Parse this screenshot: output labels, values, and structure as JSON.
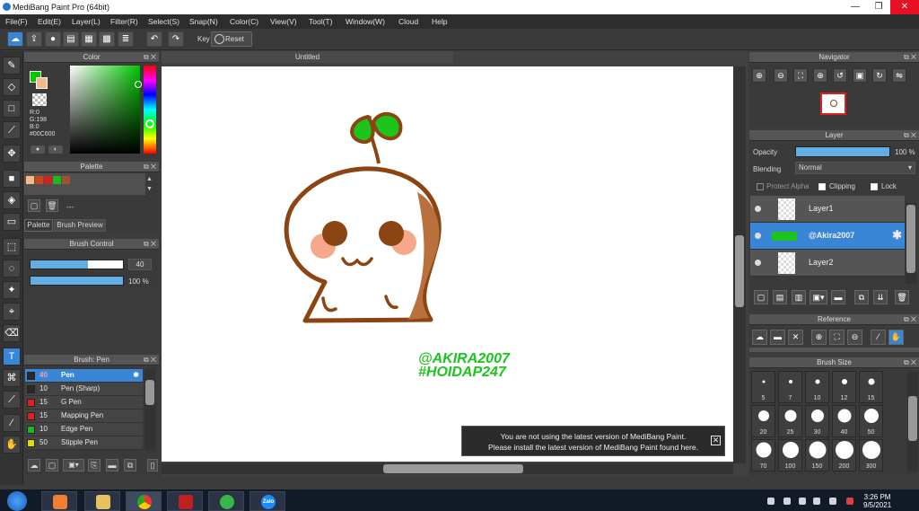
{
  "window": {
    "title": "MediBang Paint Pro (64bit)",
    "minimize": "—",
    "maximize": "❐",
    "close": "✕"
  },
  "menu": [
    "File(F)",
    "Edit(E)",
    "Layer(L)",
    "Filter(R)",
    "Select(S)",
    "Snap(N)",
    "Color(C)",
    "View(V)",
    "Tool(T)",
    "Window(W)",
    "Cloud",
    "Help"
  ],
  "toolbar": {
    "key_label": "Key",
    "reset_label": "Reset"
  },
  "color_panel": {
    "title": "Color",
    "r": "R:0",
    "g": "G:198",
    "b": "B:0",
    "hex": "#00C600",
    "primary_color": "#00c600",
    "secondary_color": "#f5b98a"
  },
  "palette_panel": {
    "title": "Palette",
    "swatches": [
      "#f5b98a",
      "#c8451c",
      "#d42020",
      "#1db81d",
      "#a0522d"
    ],
    "entry_text": "---",
    "tabs": [
      "Palette",
      "Brush Preview"
    ]
  },
  "brush_control": {
    "title": "Brush Control",
    "size": "40",
    "opacity": "100 %",
    "size_level": 0.62,
    "opacity_level": 1.0
  },
  "brush_panel": {
    "title": "Brush: Pen",
    "items": [
      {
        "size": "40",
        "name": "Pen",
        "color": "#2a2a2a"
      },
      {
        "size": "10",
        "name": "Pen (Sharp)",
        "color": "#2a2a2a"
      },
      {
        "size": "15",
        "name": "G Pen",
        "color": "#e02020"
      },
      {
        "size": "15",
        "name": "Mapping Pen",
        "color": "#e02020"
      },
      {
        "size": "10",
        "name": "Edge Pen",
        "color": "#1db81d"
      },
      {
        "size": "50",
        "name": "Stipple Pen",
        "color": "#e8d800"
      }
    ]
  },
  "canvas": {
    "tab_title": "Untitled",
    "watermark_line1": "@AKIRA2007",
    "watermark_line2": "#HOIDAP247"
  },
  "notice": {
    "line1": "You are not using the latest version of MediBang Paint.",
    "line2": "Please install the latest version of MediBang Paint found here.",
    "close": "✕"
  },
  "navigator": {
    "title": "Navigator"
  },
  "layer_panel": {
    "title": "Layer",
    "opacity_label": "Opacity",
    "opacity_value": "100 %",
    "blending_label": "Blending",
    "blending_value": "Normal",
    "protect_alpha": "Protect Alpha",
    "clipping": "Clipping",
    "lock": "Lock",
    "layers": [
      {
        "name": "Layer1"
      },
      {
        "name": "@Akira2007"
      },
      {
        "name": "Layer2"
      }
    ]
  },
  "reference_panel": {
    "title": "Reference"
  },
  "brush_size_panel": {
    "title": "Brush Size",
    "sizes": [
      "5",
      "7",
      "10",
      "12",
      "15",
      "20",
      "25",
      "30",
      "40",
      "50",
      "70",
      "100",
      "150",
      "200",
      "300"
    ]
  },
  "taskbar": {
    "time": "3:26 PM",
    "date": "9/5/2021",
    "zalo_label": "Zalo"
  }
}
